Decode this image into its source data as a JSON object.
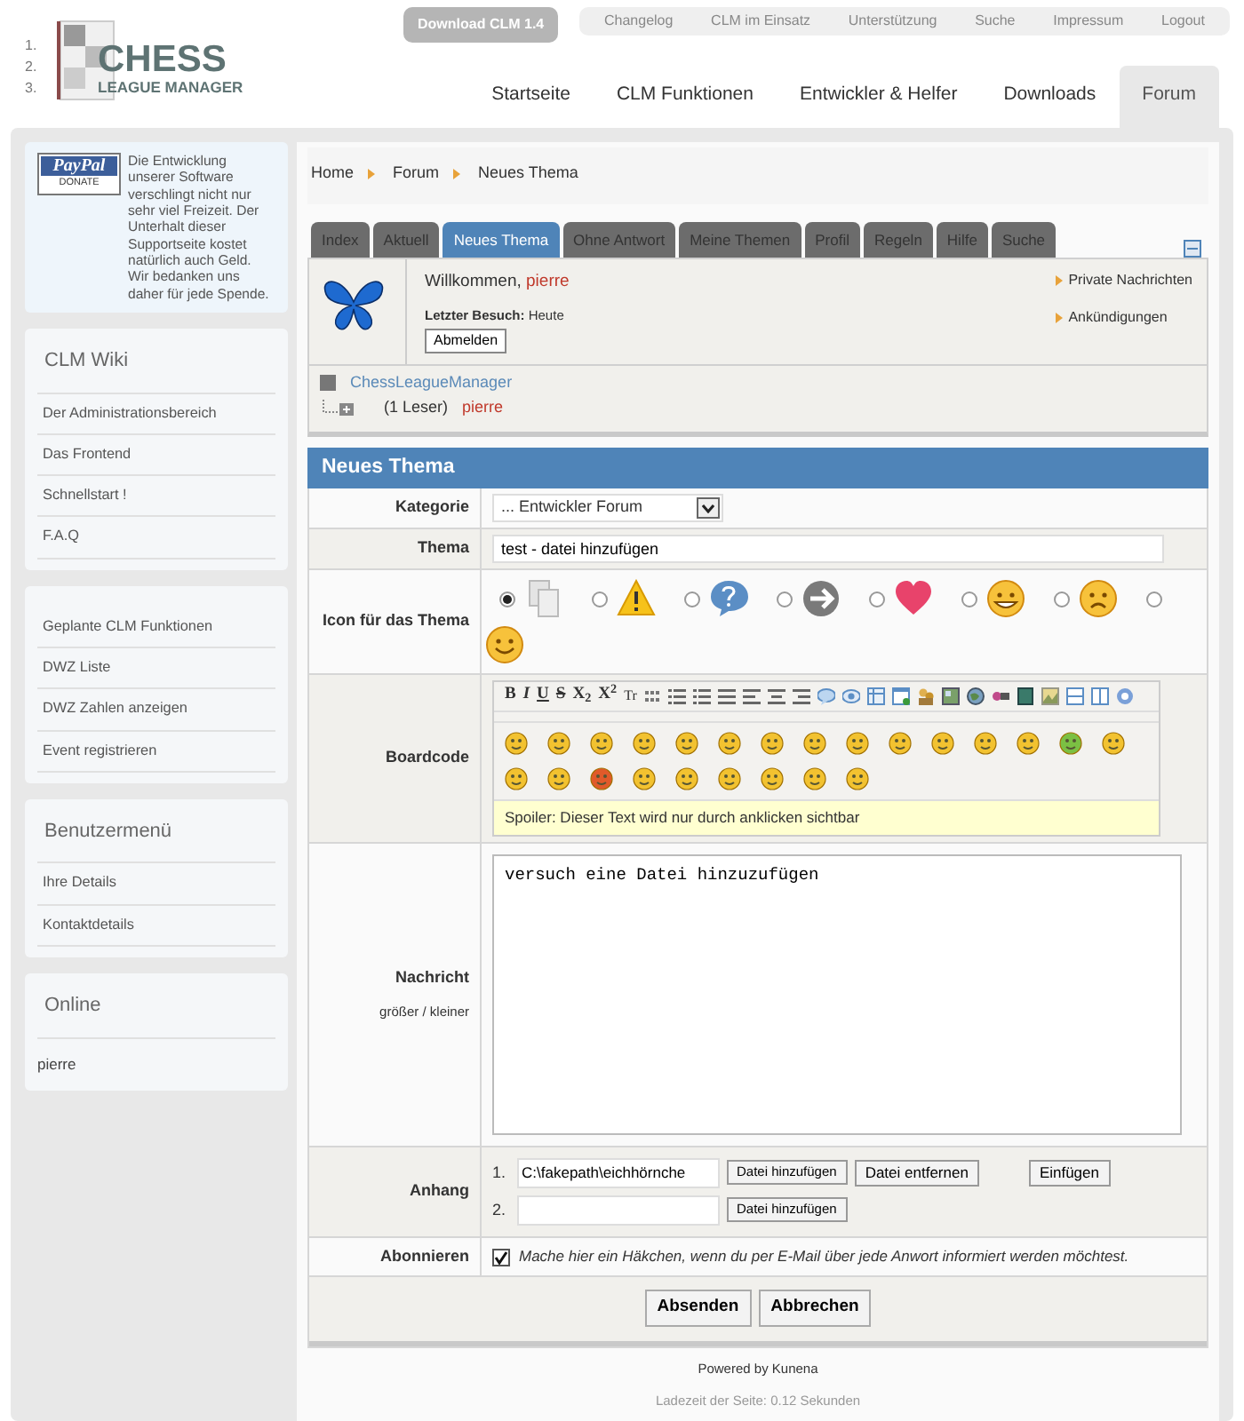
{
  "header": {
    "logo": {
      "numbers": [
        "1.",
        "2.",
        "3."
      ],
      "line1": "CHESS",
      "line2": "LEAGUE MANAGER"
    },
    "download_button": "Download CLM 1.4",
    "top_links": [
      "Changelog",
      "CLM im Einsatz",
      "Unterstützung",
      "Suche",
      "Impressum",
      "Logout"
    ],
    "main_nav": [
      {
        "label": "Startseite",
        "selected": false
      },
      {
        "label": "CLM Funktionen",
        "selected": false
      },
      {
        "label": "Entwickler & Helfer",
        "selected": false
      },
      {
        "label": "Downloads",
        "selected": false
      },
      {
        "label": "Forum",
        "selected": true
      }
    ]
  },
  "sidebar": {
    "donate": {
      "badge_top": "PayPal",
      "badge_bottom": "DONATE",
      "text": "Die Entwicklung unserer Software verschlingt nicht nur sehr viel Freizeit. Der Unterhalt dieser Supportseite kostet natürlich auch Geld. Wir bedanken uns daher für jede Spende."
    },
    "wiki": {
      "title": "CLM Wiki",
      "items": [
        "Der Administrationsbereich",
        "Das Frontend",
        "Schnellstart !",
        "F.A.Q"
      ]
    },
    "links": {
      "items": [
        "Geplante CLM Funktionen",
        "DWZ Liste",
        "DWZ Zahlen anzeigen",
        "Event registrieren"
      ]
    },
    "user_menu": {
      "title": "Benutzermenü",
      "items": [
        "Ihre Details",
        "Kontaktdetails"
      ]
    },
    "online": {
      "title": "Online",
      "users": [
        "pierre"
      ]
    }
  },
  "breadcrumb": [
    "Home",
    "Forum",
    "Neues Thema"
  ],
  "tabs": [
    {
      "label": "Index",
      "selected": false
    },
    {
      "label": "Aktuell",
      "selected": false
    },
    {
      "label": "Neues Thema",
      "selected": true
    },
    {
      "label": "Ohne Antwort",
      "selected": false
    },
    {
      "label": "Meine Themen",
      "selected": false
    },
    {
      "label": "Profil",
      "selected": false
    },
    {
      "label": "Regeln",
      "selected": false
    },
    {
      "label": "Hilfe",
      "selected": false
    },
    {
      "label": "Suche",
      "selected": false
    }
  ],
  "user_panel": {
    "greeting": "Willkommen,",
    "username": "pierre",
    "last_visit_label": "Letzter Besuch:",
    "last_visit": "Heute",
    "logout_button": "Abmelden",
    "links": [
      "Private Nachrichten",
      "Ankündigungen"
    ]
  },
  "who_is_online": {
    "category": "ChessLeagueManager",
    "readers": "(1 Leser)",
    "user": "pierre"
  },
  "form": {
    "title": "Neues Thema",
    "category": {
      "label": "Kategorie",
      "value": "... Entwickler Forum"
    },
    "subject": {
      "label": "Thema",
      "value": "test - datei hinzufügen"
    },
    "topic_icon": {
      "label": "Icon für das Thema",
      "options": [
        {
          "kind": "document",
          "selected": true
        },
        {
          "kind": "warning",
          "selected": false
        },
        {
          "kind": "question",
          "selected": false
        },
        {
          "kind": "arrow",
          "selected": false
        },
        {
          "kind": "heart",
          "selected": false
        },
        {
          "kind": "smiley-grin",
          "selected": false
        },
        {
          "kind": "smiley-sad",
          "selected": false
        },
        {
          "kind": "smiley-happy",
          "selected": false
        }
      ]
    },
    "boardcode": {
      "label": "Boardcode",
      "toolbar": [
        "B",
        "I",
        "U",
        "S",
        "X$_{2}$",
        "X$^{2}$",
        "Tr"
      ],
      "spoiler": "Spoiler: Dieser Text wird nur durch anklicken sichtbar"
    },
    "message": {
      "label": "Nachricht",
      "grow": "größer",
      "separator": "/",
      "shrink": "kleiner",
      "value": "versuch eine Datei hinzuzufügen"
    },
    "attachments": {
      "label": "Anhang",
      "files": [
        {
          "number": "1.",
          "value": "C:\\fakepath\\eichhörnche",
          "buttons": [
            "Datei hinzufügen",
            "Datei entfernen",
            "Einfügen"
          ]
        },
        {
          "number": "2.",
          "buttons": [
            "Datei hinzufügen"
          ]
        }
      ]
    },
    "subscribe": {
      "label": "Abonnieren",
      "checked": true,
      "text": "Mache hier ein Häkchen, wenn du per E-Mail über jede Anwort informiert werden möchtest."
    },
    "buttons": [
      "Absenden",
      "Abbrechen"
    ]
  },
  "footer": {
    "powered": "Powered by Kunena",
    "load_time": "Ladezeit der Seite: 0.12 Sekunden"
  }
}
